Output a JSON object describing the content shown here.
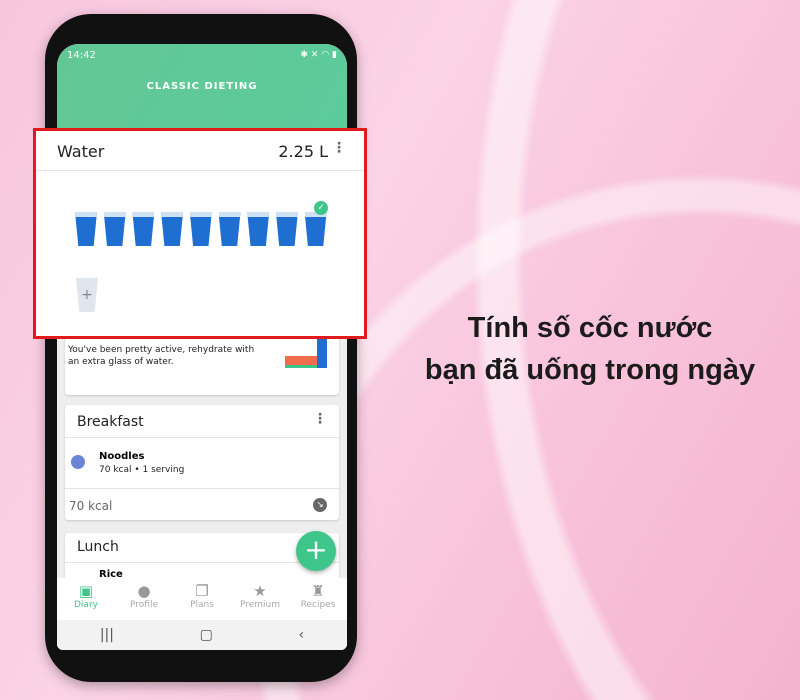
{
  "status_bar": {
    "time": "14:42",
    "icons": [
      "image-icon",
      "warning-icon",
      "settings-icon",
      "bluetooth-icon",
      "mute-icon",
      "wifi-icon",
      "signal-icon",
      "battery-icon"
    ]
  },
  "header": {
    "title": "CLASSIC DIETING"
  },
  "water": {
    "title": "Water",
    "amount": "2.25 L",
    "glasses_filled": 9,
    "add_label": "+",
    "goal_reached": true
  },
  "tip": {
    "text": "You've been pretty active, rehydrate with an extra glass of water."
  },
  "breakfast": {
    "title": "Breakfast",
    "item_name": "Noodles",
    "item_detail": "70 kcal • 1 serving",
    "total": "70 kcal"
  },
  "lunch": {
    "title": "Lunch",
    "item_name": "Rice"
  },
  "nav": [
    {
      "label": "Diary",
      "active": true
    },
    {
      "label": "Profile"
    },
    {
      "label": "Plans"
    },
    {
      "label": "Premium"
    },
    {
      "label": "Recipes"
    }
  ],
  "caption": {
    "line1": "Tính số cốc nước",
    "line2": "bạn đã uống trong ngày"
  },
  "colors": {
    "accent": "#3ec68a",
    "highlight": "#e01b1b",
    "water": "#1e6fd1"
  }
}
